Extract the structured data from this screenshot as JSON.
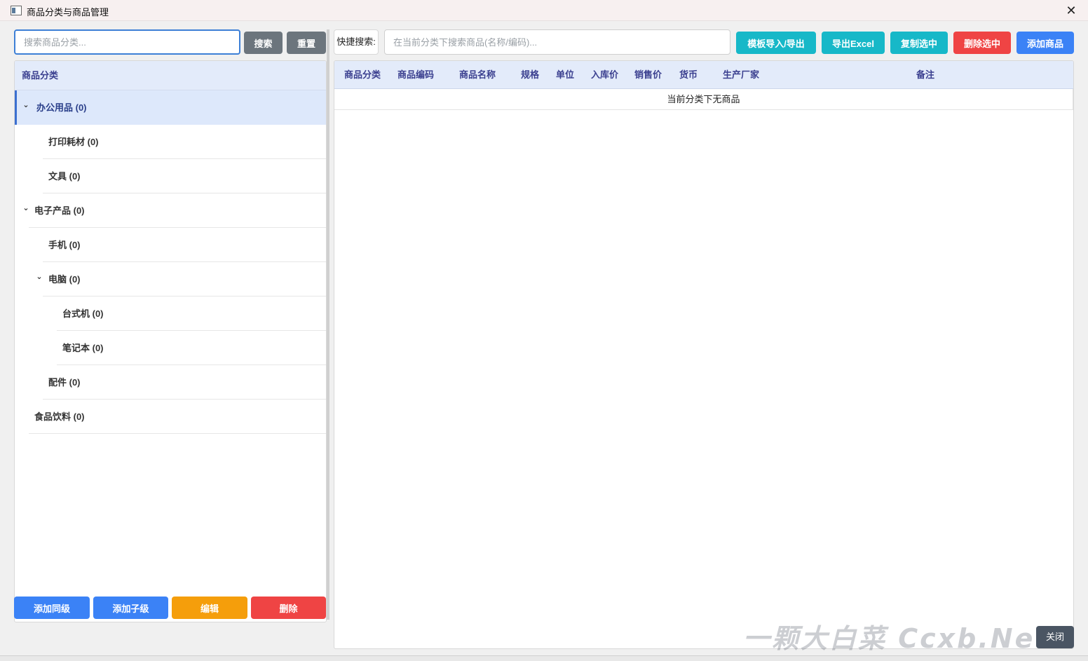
{
  "window": {
    "title": "商品分类与商品管理",
    "close_glyph": "✕"
  },
  "category_panel": {
    "search_placeholder": "搜索商品分类...",
    "search_button": "搜索",
    "reset_button": "重置",
    "tree_header": "商品分类",
    "tree": [
      {
        "label": "办公用品 (0)",
        "level": 0,
        "expanded": true,
        "selected": true
      },
      {
        "label": "打印耗材 (0)",
        "level": 1
      },
      {
        "label": "文具 (0)",
        "level": 1
      },
      {
        "label": "电子产品 (0)",
        "level": 0,
        "expanded": true
      },
      {
        "label": "手机 (0)",
        "level": 1
      },
      {
        "label": "电脑 (0)",
        "level": 1,
        "expanded": true
      },
      {
        "label": "台式机 (0)",
        "level": 2
      },
      {
        "label": "笔记本 (0)",
        "level": 2
      },
      {
        "label": "配件 (0)",
        "level": 1
      },
      {
        "label": "食品饮料 (0)",
        "level": 0
      }
    ],
    "actions": {
      "add_sibling": "添加同级",
      "add_child": "添加子级",
      "edit": "编辑",
      "delete": "删除"
    }
  },
  "product_panel": {
    "quick_search_label": "快捷搜索:",
    "quick_search_placeholder": "在当前分类下搜索商品(名称/编码)...",
    "toolbar": {
      "template_import_export": "模板导入/导出",
      "export_excel": "导出Excel",
      "copy_selected": "复制选中",
      "delete_selected": "删除选中",
      "add_product": "添加商品"
    },
    "columns": [
      "商品分类",
      "商品编码",
      "商品名称",
      "规格",
      "单位",
      "入库价",
      "销售价",
      "货币",
      "生产厂家",
      "备注"
    ],
    "empty_text": "当前分类下无商品"
  },
  "footer": {
    "close_button": "关闭",
    "watermark": "一颗大白菜 Ccxb.Net"
  },
  "colors": {
    "primary_blue": "#3b82f6",
    "teal": "#17b8c8",
    "danger_red": "#ef4444",
    "warning_orange": "#f59e0b",
    "gray": "#6c757d",
    "header_bg": "#e3ebfa"
  }
}
